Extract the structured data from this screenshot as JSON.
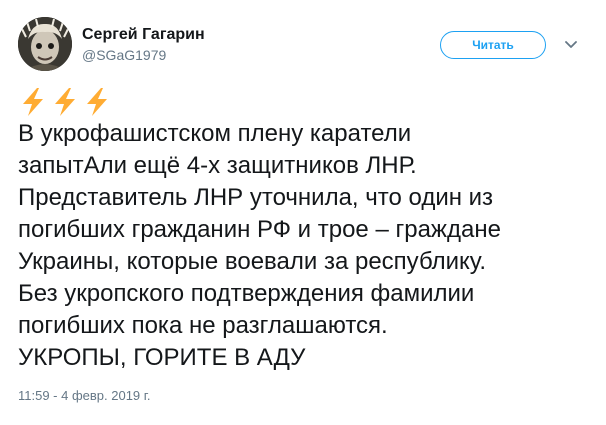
{
  "colors": {
    "accent": "#1da1f2",
    "text_primary": "#14171a",
    "text_secondary": "#657786",
    "bolt_fill": "#ffac33"
  },
  "user": {
    "display_name": "Сергей Гагарин",
    "handle": "@SGaG1979",
    "avatar_icon": "avatar-portrait"
  },
  "actions": {
    "follow_label": "Читать",
    "more_icon": "chevron-down-icon"
  },
  "tweet": {
    "emoji": [
      "high-voltage-icon",
      "high-voltage-icon",
      "high-voltage-icon"
    ],
    "lines": [
      "В укрофашистском плену каратели",
      "запытАли ещё 4-х защитников ЛНР.",
      "Представитель ЛНР уточнила, что один из",
      "погибших гражданин РФ и трое – граждане",
      "Украины, которые воевали за республику.",
      "Без укропского подтверждения фамилии",
      "погибших пока не разглашаются.",
      "УКРОПЫ, ГОРИТЕ В АДУ"
    ],
    "timestamp": "11:59 - 4 февр. 2019 г."
  }
}
